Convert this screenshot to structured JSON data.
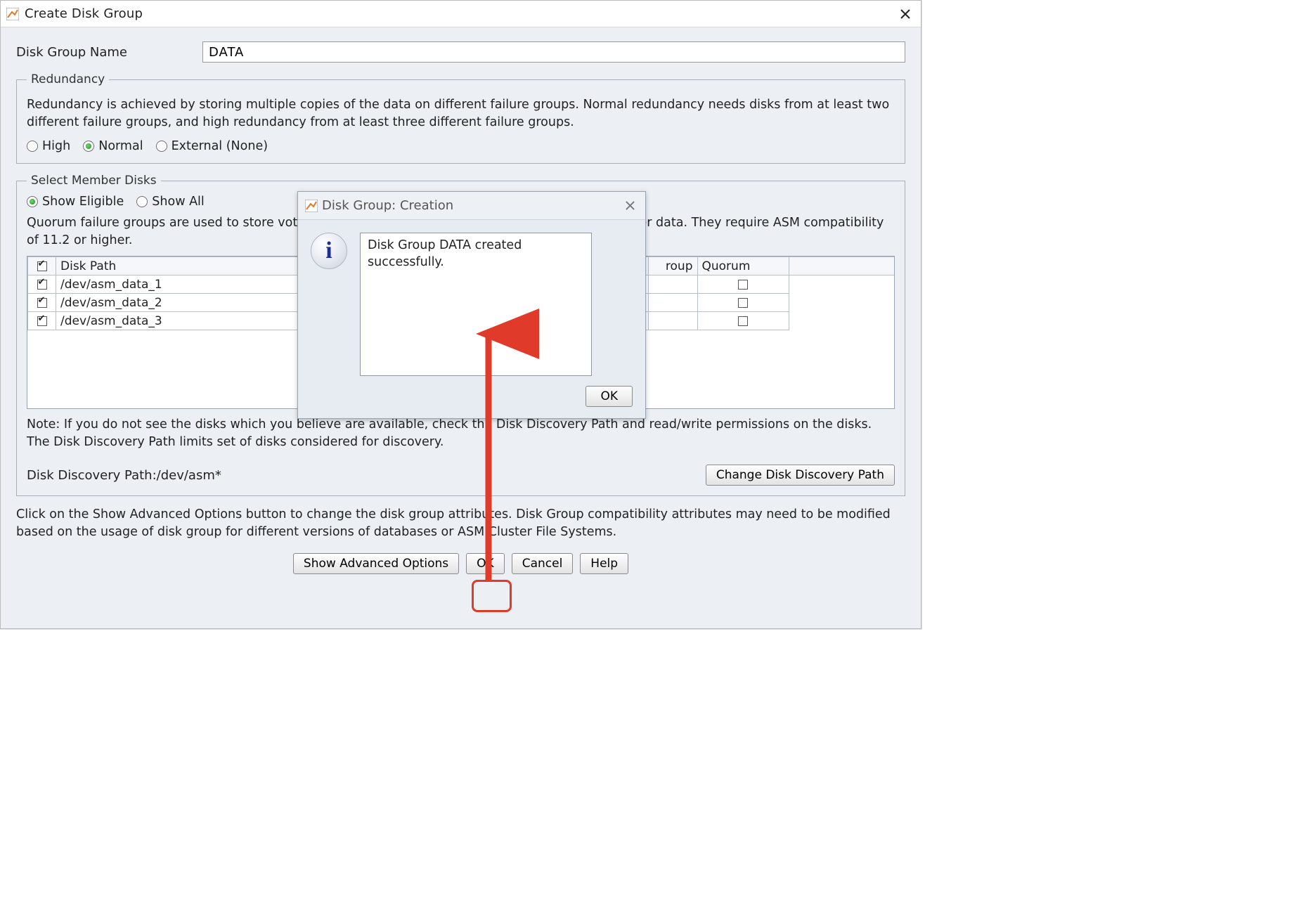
{
  "window": {
    "title": "Create Disk Group"
  },
  "diskGroup": {
    "nameLabel": "Disk Group Name",
    "nameValue": "DATA"
  },
  "redundancy": {
    "legend": "Redundancy",
    "desc": "Redundancy is achieved by storing multiple copies of the data on different failure groups. Normal redundancy needs disks from at least two different failure groups, and high redundancy from at least three different failure groups.",
    "options": {
      "high": "High",
      "normal": "Normal",
      "external": "External (None)"
    },
    "selected": "normal"
  },
  "memberDisks": {
    "legend": "Select Member Disks",
    "filter": {
      "eligible": "Show Eligible",
      "all": "Show All"
    },
    "filterSelected": "eligible",
    "quorumDesc": "Quorum failure groups are used to store voting files in extended clusters and do not contain any user data. They require ASM compatibility of 11.2 or higher.",
    "columns": {
      "path": "Disk Path",
      "groupSuffix": "roup",
      "quorum": "Quorum"
    },
    "rows": [
      {
        "checked": true,
        "path": "/dev/asm_data_1",
        "quorum": false
      },
      {
        "checked": true,
        "path": "/dev/asm_data_2",
        "quorum": false
      },
      {
        "checked": true,
        "path": "/dev/asm_data_3",
        "quorum": false
      }
    ],
    "noteLine1": "Note: If you do not see the disks which you believe are available, check the Disk Discovery Path and read/write permissions on the disks.",
    "noteLine2": "The Disk Discovery Path limits set of disks considered for discovery.",
    "discoveryLabel": "Disk Discovery Path:",
    "discoveryValue": "/dev/asm*",
    "changePathBtn": "Change Disk Discovery Path"
  },
  "footer": {
    "advNote": "Click on the Show Advanced Options button to change the disk group attributes. Disk Group compatibility attributes may need to be modified based on the usage of disk group for different versions of databases or ASM Cluster File Systems.",
    "showAdvanced": "Show Advanced Options",
    "ok": "OK",
    "cancel": "Cancel",
    "help": "Help"
  },
  "modal": {
    "title": "Disk Group: Creation",
    "message": "Disk Group DATA created successfully.",
    "ok": "OK"
  }
}
